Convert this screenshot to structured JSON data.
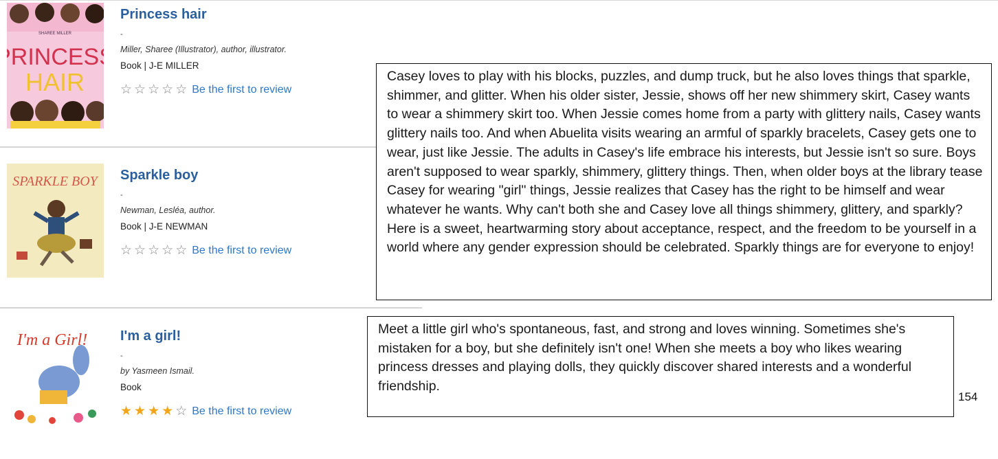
{
  "records": [
    {
      "title": "Princess hair",
      "dash": "-",
      "author": "Miller, Sharee (Illustrator), author, illustrator.",
      "format": "Book | J-E MILLER",
      "stars_filled": 0,
      "review_link": "Be the first to review",
      "cover_text": "PRINCESS HAIR",
      "cover_small": "SHAREE MILLER"
    },
    {
      "title": "Sparkle boy",
      "dash": "-",
      "author": "Newman, Lesléa, author.",
      "format": "Book | J-E NEWMAN",
      "stars_filled": 0,
      "review_link": "Be the first to review",
      "cover_text": "SPARKLE BOY"
    },
    {
      "title": "I'm a girl!",
      "dash": "-",
      "author": "by Yasmeen Ismail.",
      "format": "Book",
      "stars_filled": 4,
      "review_link": "Be the first to review",
      "cover_text": "I'm a Girl!"
    }
  ],
  "summaries": [
    "Casey loves to play with his blocks, puzzles, and dump truck, but he also loves things that sparkle, shimmer, and glitter. When his older sister, Jessie, shows off her new shimmery skirt, Casey wants to wear a shimmery skirt too. When Jessie comes home from a party with glittery nails, Casey wants glittery nails too. And when Abuelita visits wearing an armful of sparkly bracelets, Casey gets one to wear, just like Jessie. The adults in Casey's life embrace his interests, but Jessie isn't so sure. Boys aren't supposed to wear sparkly, shimmery, glittery things. Then, when older boys at the library tease Casey for wearing \"girl\" things, Jessie realizes that Casey has the right to be himself and wear whatever he wants. Why can't both she and Casey love all things shimmery, glittery, and sparkly? Here is a sweet, heartwarming story about acceptance, respect, and the freedom to be yourself in a world where any gender expression should be celebrated. Sparkly things are for everyone to enjoy!",
    "Meet a little girl who's spontaneous, fast, and strong and loves winning. Sometimes she's mistaken for a boy, but she definitely isn't one! When she meets a boy who likes wearing princess dresses and playing dolls, they quickly discover shared interests and a wonderful friendship."
  ],
  "page_number": "154",
  "colors": {
    "title": "#2a5f9e",
    "link": "#2d78c8",
    "star_filled": "#f1a61a",
    "star_empty": "#888888"
  },
  "icons": {
    "star_empty": "☆",
    "star_filled": "★"
  }
}
